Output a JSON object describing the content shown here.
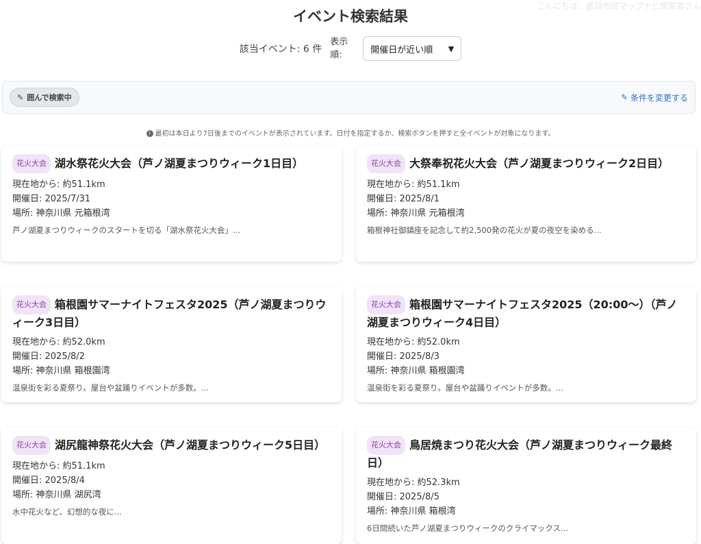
{
  "header": {
    "greeting": "こんにちは、盛岡市民マップナビ閲覧者さん",
    "title": "イベント検索結果"
  },
  "sort": {
    "count_text": "該当イベント: 6 件",
    "label": "表示順:",
    "selected": "開催日が近い順"
  },
  "filter": {
    "chip_label": "囲んで検索中",
    "change_label": "条件を変更する"
  },
  "note": "最初は本日より7日後までのイベントが表示されています。日付を指定するか、検索ボタンを押すと全イベントが対象になります。",
  "events": [
    {
      "tag": "花火大会",
      "title": "湖水祭花火大会（芦ノ湖夏まつりウィーク1日目）",
      "distance": "現在地から: 約51.1km",
      "date": "開催日: 2025/7/31",
      "place": "場所: 神奈川県 元箱根湾",
      "desc": "芦ノ湖夏まつりウィークのスタートを切る「湖水祭花火大会」..."
    },
    {
      "tag": "花火大会",
      "title": "大祭奉祝花火大会（芦ノ湖夏まつりウィーク2日目）",
      "distance": "現在地から: 約51.1km",
      "date": "開催日: 2025/8/1",
      "place": "場所: 神奈川県 元箱根湾",
      "desc": "箱根神社御鎮座を記念して約2,500発の花火が夏の夜空を染める..."
    },
    {
      "tag": "花火大会",
      "title": "箱根園サマーナイトフェスタ2025（芦ノ湖夏まつりウィーク3日目）",
      "distance": "現在地から: 約52.0km",
      "date": "開催日: 2025/8/2",
      "place": "場所: 神奈川県 箱根園湾",
      "desc": "温泉街を彩る夏祭り。屋台や盆踊りイベントが多数。..."
    },
    {
      "tag": "花火大会",
      "title": "箱根園サマーナイトフェスタ2025（20:00～）（芦ノ湖夏まつりウィーク4日目）",
      "distance": "現在地から: 約52.0km",
      "date": "開催日: 2025/8/3",
      "place": "場所: 神奈川県 箱根園湾",
      "desc": "温泉街を彩る夏祭り。屋台や盆踊りイベントが多数。..."
    },
    {
      "tag": "花火大会",
      "title": "湖尻龍神祭花火大会（芦ノ湖夏まつりウィーク5日目）",
      "distance": "現在地から: 約51.1km",
      "date": "開催日: 2025/8/4",
      "place": "場所: 神奈川県 湖尻湾",
      "desc": "水中花火など、幻想的な夜に..."
    },
    {
      "tag": "花火大会",
      "title": "鳥居焼まつり花火大会（芦ノ湖夏まつりウィーク最終日）",
      "distance": "現在地から: 約52.3km",
      "date": "開催日: 2025/8/5",
      "place": "場所: 神奈川県 箱根湾",
      "desc": "6日間続いた芦ノ湖夏まつりウィークのクライマックス..."
    }
  ],
  "colors": {
    "tag_bg": "#f1e3f8",
    "tag_text": "#8a3fa8",
    "link": "#2f6fd6"
  }
}
